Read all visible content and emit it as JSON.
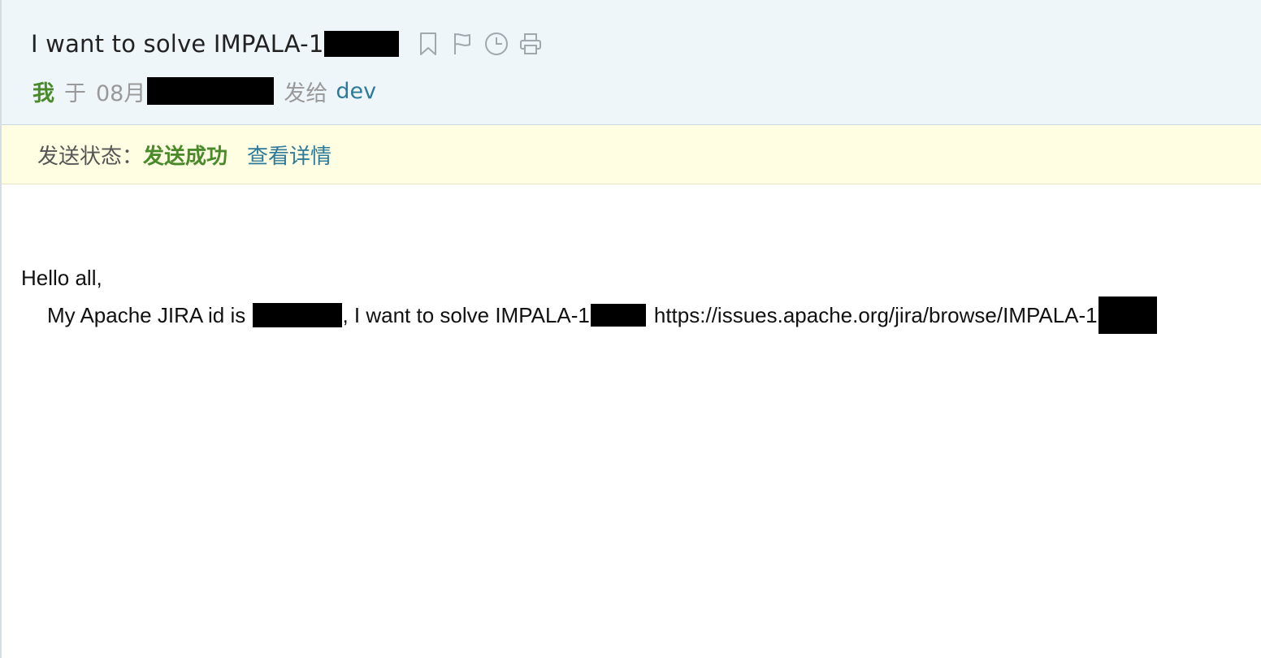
{
  "email": {
    "subject": "I want to solve IMPALA-1",
    "toolbar": {
      "icons": [
        "bookmark-icon",
        "flag-icon",
        "clock-icon",
        "print-icon"
      ]
    },
    "meta": {
      "sender": "我",
      "at": "于",
      "date_prefix": "08月",
      "sent_to": "发给",
      "recipient": "dev"
    },
    "status": {
      "label": "发送状态：",
      "value": "发送成功",
      "details_link": "查看详情"
    },
    "body": {
      "greeting": "Hello all,",
      "line_part1": "My Apache JIRA id is ",
      "line_part2": ", I want to solve IMPALA-1",
      "line_part3": "https://issues.apache.org/jira/browse/IMPALA-1"
    }
  },
  "colors": {
    "header_bg": "#eef6fa",
    "status_bg": "#fffde2",
    "green": "#4a8a2b",
    "link_blue": "#2e7a99",
    "redaction": "#000000"
  }
}
